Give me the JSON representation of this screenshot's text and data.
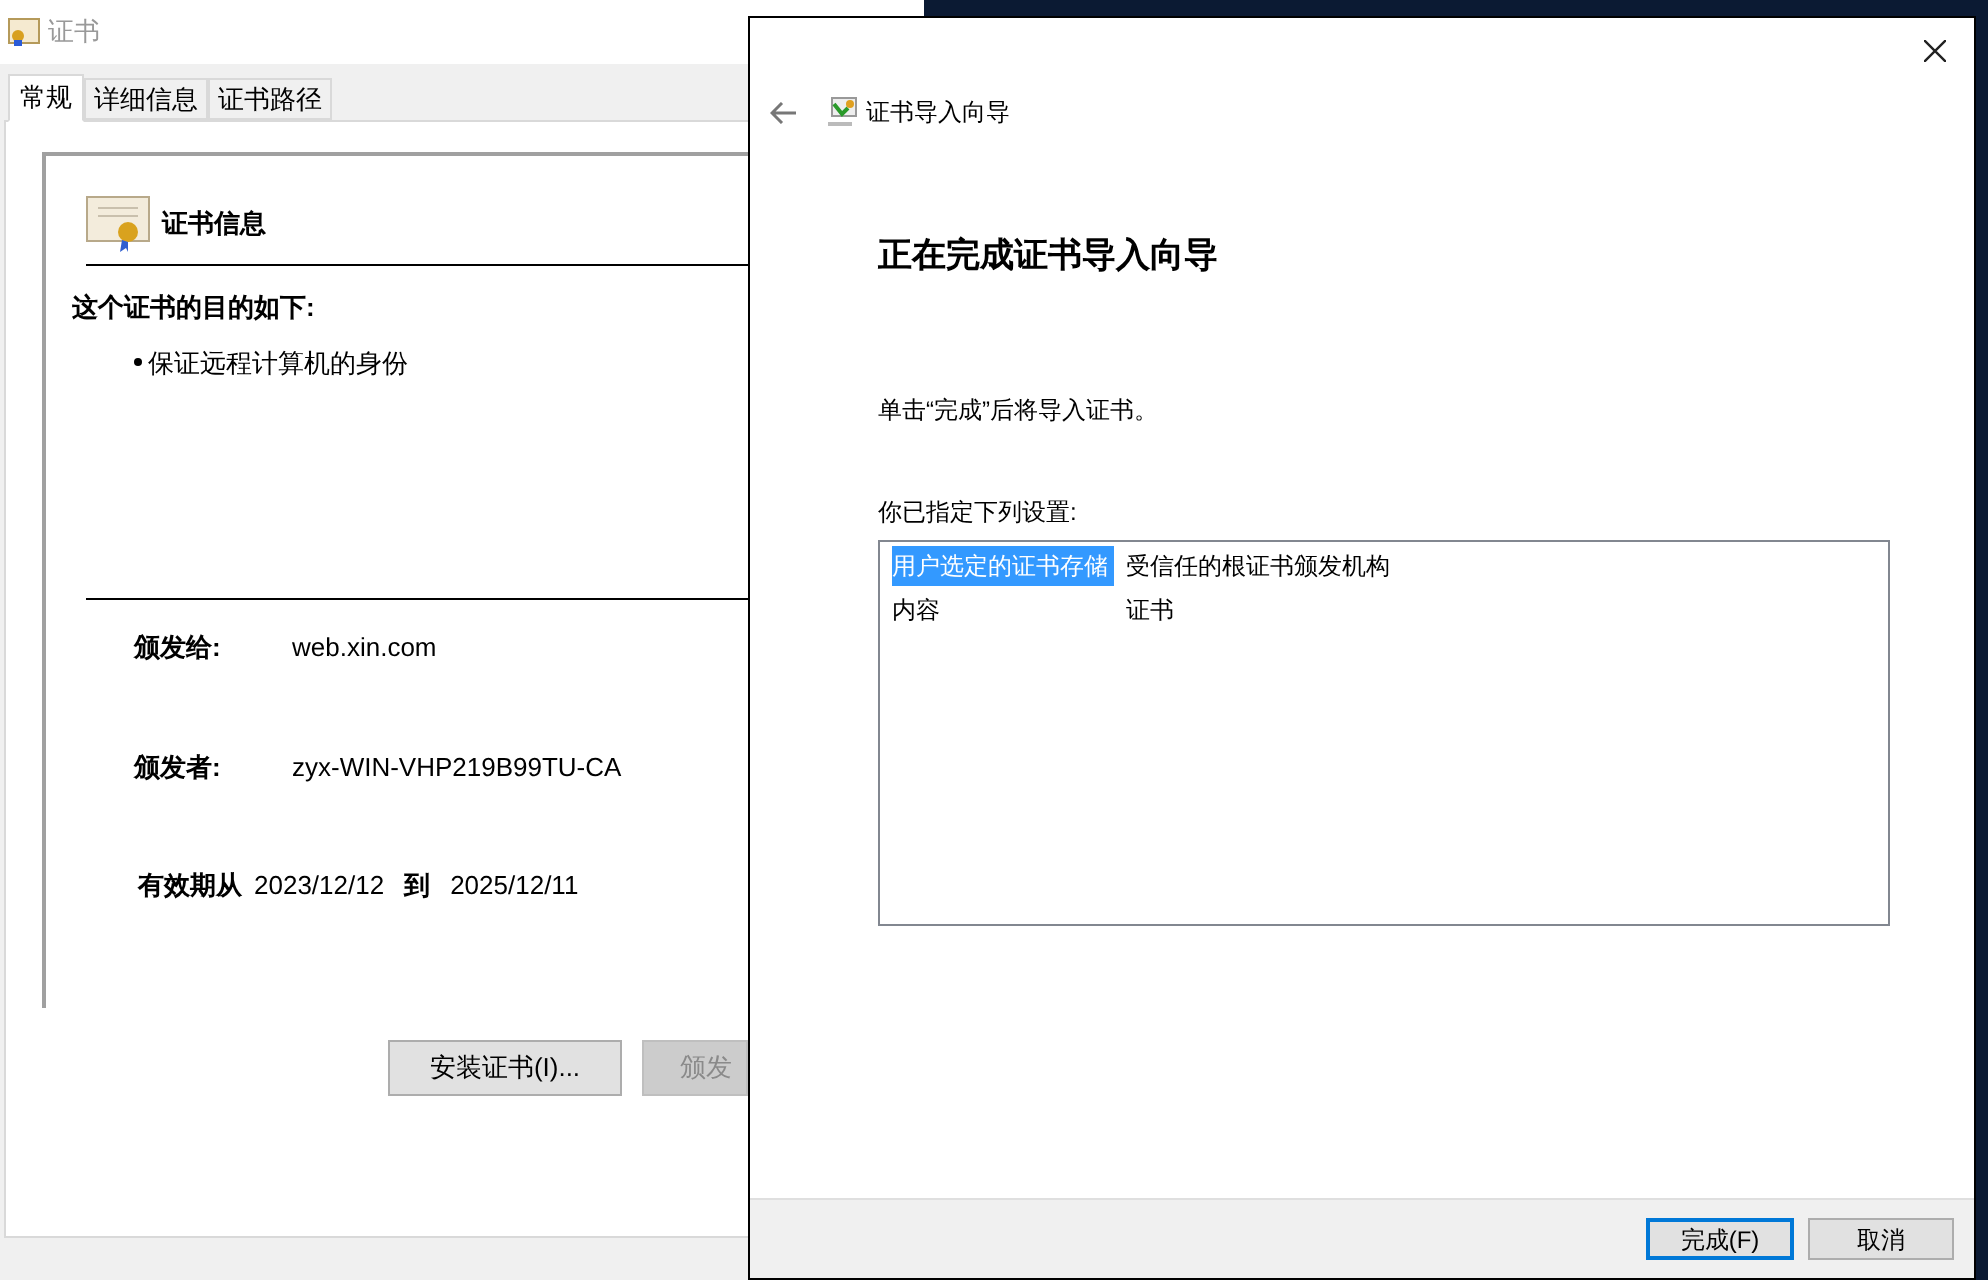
{
  "cert_window": {
    "title": "证书",
    "tabs": [
      {
        "label": "常规",
        "selected": true
      },
      {
        "label": "详细信息",
        "selected": false
      },
      {
        "label": "证书路径",
        "selected": false
      }
    ],
    "heading": "证书信息",
    "purpose_title": "这个证书的目的如下:",
    "purposes": [
      "保证远程计算机的身份"
    ],
    "issued_to_label": "颁发给:",
    "issued_to": "web.xin.com",
    "issued_by_label": "颁发者:",
    "issued_by": "zyx-WIN-VHP219B99TU-CA",
    "valid_from_label": "有效期从",
    "valid_from": "2023/12/12",
    "valid_to_label": "到",
    "valid_to": "2025/12/11",
    "buttons": [
      {
        "label": "安装证书(I)...",
        "disabled": false
      },
      {
        "label": "颁发",
        "disabled": true
      }
    ]
  },
  "wizard": {
    "title": "证书导入向导",
    "heading": "正在完成证书导入向导",
    "message": "单击“完成”后将导入证书。",
    "settings_label": "你已指定下列设置:",
    "settings": [
      {
        "name": "用户选定的证书存储",
        "value": "受信任的根证书颁发机构",
        "selected": true
      },
      {
        "name": "内容",
        "value": "证书",
        "selected": false
      }
    ],
    "buttons": [
      {
        "label": "完成(F)",
        "default": true
      },
      {
        "label": "取消",
        "default": false
      }
    ]
  }
}
